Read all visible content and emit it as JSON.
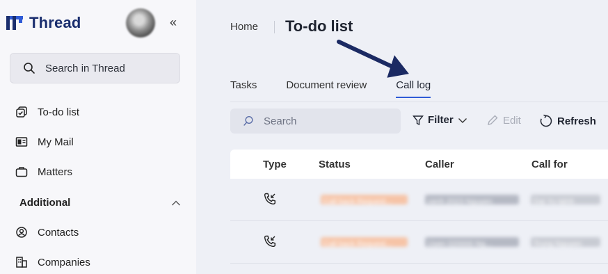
{
  "app": {
    "name": "Thread",
    "brand_color": "#1a2e6e",
    "accent_color": "#2f5bd6"
  },
  "sidebar": {
    "collapse_icon": "double-chevron-left-icon",
    "search_label": "Search in Thread",
    "items": [
      {
        "label": "To-do list",
        "icon": "checklist-icon"
      },
      {
        "label": "My Mail",
        "icon": "mail-icon"
      },
      {
        "label": "Matters",
        "icon": "briefcase-icon"
      }
    ],
    "section": {
      "label": "Additional",
      "icon": "chevron-up-icon"
    },
    "section_items": [
      {
        "label": "Contacts",
        "icon": "contact-icon"
      },
      {
        "label": "Companies",
        "icon": "building-icon"
      }
    ]
  },
  "breadcrumb": {
    "home": "Home",
    "current": "To-do list"
  },
  "tabs": [
    {
      "label": "Tasks",
      "active": false
    },
    {
      "label": "Document review",
      "active": false
    },
    {
      "label": "Call log",
      "active": true
    }
  ],
  "toolbar": {
    "search_placeholder": "Search",
    "filter_label": "Filter",
    "edit_label": "Edit",
    "refresh_label": "Refresh"
  },
  "table": {
    "columns": [
      "Type",
      "Status",
      "Caller",
      "Call for"
    ],
    "rows": [
      {
        "type_icon": "incoming-call-icon",
        "status": "Call back Request...",
        "caller": "cenh 2023 Nguyen",
        "call_for": "Dai Yu lalnh"
      },
      {
        "type_icon": "incoming-call-icon",
        "status": "Call back Request...",
        "caller": "Uyen 020000 Ng...",
        "call_for": "Trung Nguyen"
      }
    ]
  }
}
